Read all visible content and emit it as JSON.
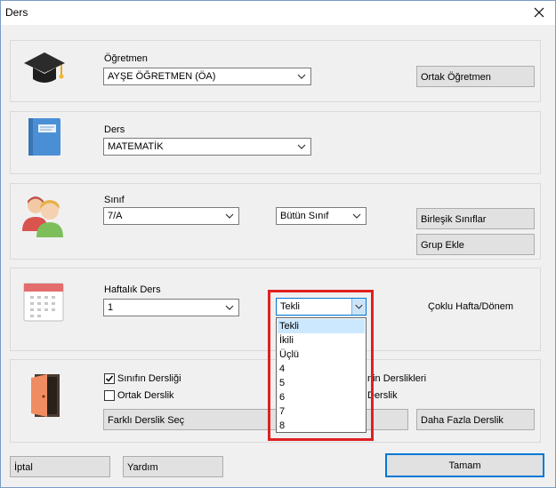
{
  "window": {
    "title": "Ders"
  },
  "teacher": {
    "label": "Öğretmen",
    "value": "AYŞE ÖĞRETMEN (ÖA)",
    "co_teacher_button": "Ortak Öğretmen"
  },
  "subject": {
    "label": "Ders",
    "value": "MATEMATİK"
  },
  "class": {
    "label": "Sınıf",
    "value": "7/A",
    "scope_value": "Bütün Sınıf",
    "combined_button": "Birleşik Sınıflar",
    "group_button": "Grup Ekle"
  },
  "weekly": {
    "label": "Haftalık Ders",
    "value": "1",
    "frequency_value": "Tekli",
    "multi_week_button": "Çoklu Hafta/Dönem",
    "frequency_options": [
      "Tekli",
      "İkili",
      "Üçlü",
      "4",
      "5",
      "6",
      "7",
      "8"
    ],
    "selected_index": 0
  },
  "room": {
    "class_room_checkbox": "Sınıfın Dersliği",
    "class_room_checked": true,
    "shared_room_checkbox": "Ortak Derslik",
    "shared_room_checked": false,
    "teacher_rooms_partial": "nin Derslikleri",
    "room_partial": "Derslik",
    "other_room_button": "Farklı Derslik Seç",
    "more_rooms_button": "Daha Fazla Derslik"
  },
  "footer": {
    "cancel": "İptal",
    "help": "Yardım",
    "ok": "Tamam"
  }
}
